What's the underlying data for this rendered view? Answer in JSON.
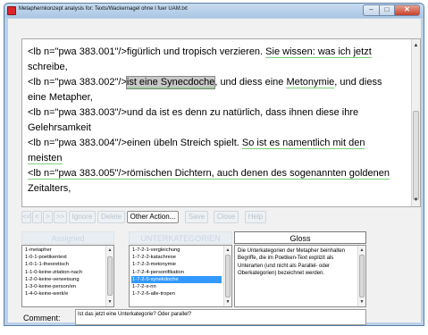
{
  "window": {
    "title": "Metaphernkonzept analysis for: Texts/Wackernagel ohne I fuer UAM.txt",
    "close_glyph": "✕",
    "maximize_glyph": "□",
    "minimize_glyph": "–"
  },
  "text_pane": {
    "lines": [
      {
        "pre": "<lb n=\"pwa 383.001\"/>figürlich und tropisch verzieren. ",
        "ul1": "Sie wissen: was ich jetzt",
        "post": "",
        "ul2": "",
        "tail": ""
      },
      {
        "pre": "schreibe,",
        "ul1": "",
        "post": "",
        "ul2": "",
        "tail": ""
      },
      {
        "pre": "<lb n=\"pwa 383.002\"/>",
        "hl": "ist eine Synecdoche",
        "mid": ", und diess eine ",
        "ul1": "Metonymie",
        "post": ", und diess"
      },
      {
        "pre": "eine Metapher,",
        "ul1": "",
        "post": ""
      },
      {
        "pre": "<lb n=\"pwa 383.003\"/>und da ist es denn zu natürlich, dass ihnen diese ihre",
        "ul1": "",
        "post": ""
      },
      {
        "pre": "Gelehrsamkeit",
        "ul1": "",
        "post": ""
      },
      {
        "pre": "<lb n=\"pwa 383.004\"/>einen übeln Streich spielt. ",
        "ul1": "So ist es namentlich mit den",
        "post": ""
      },
      {
        "pre": "",
        "ul1": "meisten",
        "post": ""
      },
      {
        "pre": "<lb n=\"pwa 383.005\"/>römischen Dichtern, auch denen des sogenannten goldenen",
        "ul1": "",
        "post": ""
      },
      {
        "pre": "Zeitalters,",
        "ul1": "",
        "post": ""
      }
    ],
    "scroll_up": "▲",
    "scroll_down": "▼"
  },
  "toolbar": {
    "buttons": [
      "<<",
      "<",
      ">",
      ">>",
      "Ignore",
      "Delete",
      "Other Action...",
      "Save",
      "Close",
      "Help"
    ],
    "active_index": 6
  },
  "assigned": {
    "header": "Assigned",
    "items": [
      "1-metapher",
      "1-0-1-poetikentext",
      "1-0-1-1-theoretisch",
      "1-1-0-keine-zitation-nach",
      "1-2-0-keine-verweisung",
      "1-3-0-keine-person/en",
      "1-4-0-keine-werk/e"
    ]
  },
  "unterkategorien": {
    "header": "UNTERKATEGORIEN",
    "items": [
      "1-7-2-1-vergleichung",
      "1-7-2-2-katachrese",
      "1-7-2-3-metonymie",
      "1-7-2-4-personifikation",
      "1-7-2-5-synekdoche",
      "1-7-2-x-nn",
      "1-7-2-6-alle-tropen"
    ],
    "selected_index": 4
  },
  "gloss": {
    "header": "Gloss",
    "text": "Die Unterkategorien der Metapher beinhalten Begriffe, die im Poetiken-Text explizit als Unterarten (und nicht als Parallel- oder Oberkategorien) bezeichnet werden."
  },
  "comment": {
    "label": "Comment:",
    "value": "Ist das jetzt eine Unterkategorie? Oder parallel?"
  },
  "colors": {
    "window_frame": "#b9d1ea",
    "client_bg": "#f1f1f1",
    "selection": "#3399ff",
    "underline": "#7bd17b",
    "close_button": "#c7412b"
  }
}
